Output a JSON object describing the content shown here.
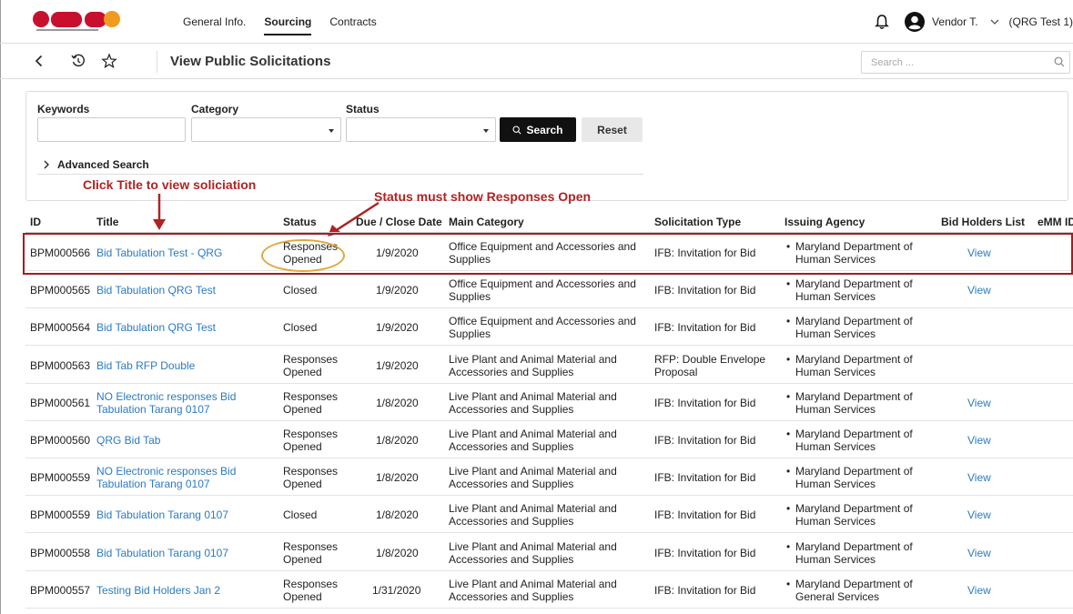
{
  "nav": {
    "links": [
      "General Info.",
      "Sourcing",
      "Contracts"
    ],
    "active": "Sourcing",
    "user": "Vendor T.",
    "org": "(QRG Test 1)"
  },
  "header": {
    "title": "View Public Solicitations",
    "search_placeholder": "Search ..."
  },
  "filters": {
    "keywords_label": "Keywords",
    "category_label": "Category",
    "status_label": "Status",
    "search_button": "Search",
    "reset_button": "Reset",
    "advanced_label": "Advanced Search"
  },
  "annotations": {
    "title_hint": "Click Title to view soliciation",
    "status_hint": "Status must show Responses Open"
  },
  "table": {
    "columns": [
      "ID",
      "Title",
      "Status",
      "Due / Close Date",
      "Main Category",
      "Solicitation Type",
      "Issuing Agency",
      "Bid Holders List",
      "eMM ID"
    ],
    "rows": [
      {
        "id": "BPM000566",
        "title": [
          "Bid Tabulation Test - QRG"
        ],
        "status": [
          "Responses",
          "Opened"
        ],
        "date": "1/9/2020",
        "category": [
          "Office Equipment and Accessories and",
          "Supplies"
        ],
        "type": [
          "IFB: Invitation for Bid"
        ],
        "agency": [
          "Maryland Department of",
          "Human Services"
        ],
        "bid_holders": "View"
      },
      {
        "id": "BPM000565",
        "title": [
          "Bid Tabulation QRG Test"
        ],
        "status": [
          "Closed"
        ],
        "date": "1/9/2020",
        "category": [
          "Office Equipment and Accessories and",
          "Supplies"
        ],
        "type": [
          "IFB: Invitation for Bid"
        ],
        "agency": [
          "Maryland Department of",
          "Human Services"
        ],
        "bid_holders": "View"
      },
      {
        "id": "BPM000564",
        "title": [
          "Bid Tabulation QRG Test"
        ],
        "status": [
          "Closed"
        ],
        "date": "1/9/2020",
        "category": [
          "Office Equipment and Accessories and",
          "Supplies"
        ],
        "type": [
          "IFB: Invitation for Bid"
        ],
        "agency": [
          "Maryland Department of",
          "Human Services"
        ],
        "bid_holders": ""
      },
      {
        "id": "BPM000563",
        "title": [
          "Bid Tab RFP Double"
        ],
        "status": [
          "Responses",
          "Opened"
        ],
        "date": "1/9/2020",
        "category": [
          "Live Plant and Animal Material and",
          "Accessories and Supplies"
        ],
        "type": [
          "RFP: Double Envelope",
          "Proposal"
        ],
        "agency": [
          "Maryland Department of",
          "Human Services"
        ],
        "bid_holders": ""
      },
      {
        "id": "BPM000561",
        "title": [
          "NO Electronic responses Bid",
          "Tabulation Tarang 0107"
        ],
        "status": [
          "Responses",
          "Opened"
        ],
        "date": "1/8/2020",
        "category": [
          "Live Plant and Animal Material and",
          "Accessories and Supplies"
        ],
        "type": [
          "IFB: Invitation for Bid"
        ],
        "agency": [
          "Maryland Department of",
          "Human Services"
        ],
        "bid_holders": "View"
      },
      {
        "id": "BPM000560",
        "title": [
          "QRG Bid Tab"
        ],
        "status": [
          "Responses",
          "Opened"
        ],
        "date": "1/8/2020",
        "category": [
          "Live Plant and Animal Material and",
          "Accessories and Supplies"
        ],
        "type": [
          "IFB: Invitation for Bid"
        ],
        "agency": [
          "Maryland Department of",
          "Human Services"
        ],
        "bid_holders": "View"
      },
      {
        "id": "BPM000559",
        "title": [
          "NO Electronic responses Bid",
          "Tabulation Tarang 0107"
        ],
        "status": [
          "Responses",
          "Opened"
        ],
        "date": "1/8/2020",
        "category": [
          "Live Plant and Animal Material and",
          "Accessories and Supplies"
        ],
        "type": [
          "IFB: Invitation for Bid"
        ],
        "agency": [
          "Maryland Department of",
          "Human Services"
        ],
        "bid_holders": "View"
      },
      {
        "id": "BPM000559",
        "title": [
          "Bid Tabulation Tarang 0107"
        ],
        "status": [
          "Closed"
        ],
        "date": "1/8/2020",
        "category": [
          "Live Plant and Animal Material and",
          "Accessories and Supplies"
        ],
        "type": [
          "IFB: Invitation for Bid"
        ],
        "agency": [
          "Maryland Department of",
          "Human Services"
        ],
        "bid_holders": "View"
      },
      {
        "id": "BPM000558",
        "title": [
          "Bid Tabulation Tarang 0107"
        ],
        "status": [
          "Responses",
          "Opened"
        ],
        "date": "1/8/2020",
        "category": [
          "Live Plant and Animal Material and",
          "Accessories and Supplies"
        ],
        "type": [
          "IFB: Invitation for Bid"
        ],
        "agency": [
          "Maryland Department of",
          "Human Services"
        ],
        "bid_holders": "View"
      },
      {
        "id": "BPM000557",
        "title": [
          "Testing Bid Holders Jan 2"
        ],
        "status": [
          "Responses",
          "Opened"
        ],
        "date": "1/31/2020",
        "category": [
          "Live Plant and Animal Material and",
          "Accessories and Supplies"
        ],
        "type": [
          "IFB: Invitation for Bid"
        ],
        "agency": [
          "Maryland Department of",
          "General Services"
        ],
        "bid_holders": "View"
      }
    ]
  },
  "colors": {
    "link": "#2a7bc4",
    "annotation": "#b22222",
    "highlight_oval": "#e0a93a",
    "logo_orange": "#f29a1f",
    "logo_red": "#c8102e"
  }
}
